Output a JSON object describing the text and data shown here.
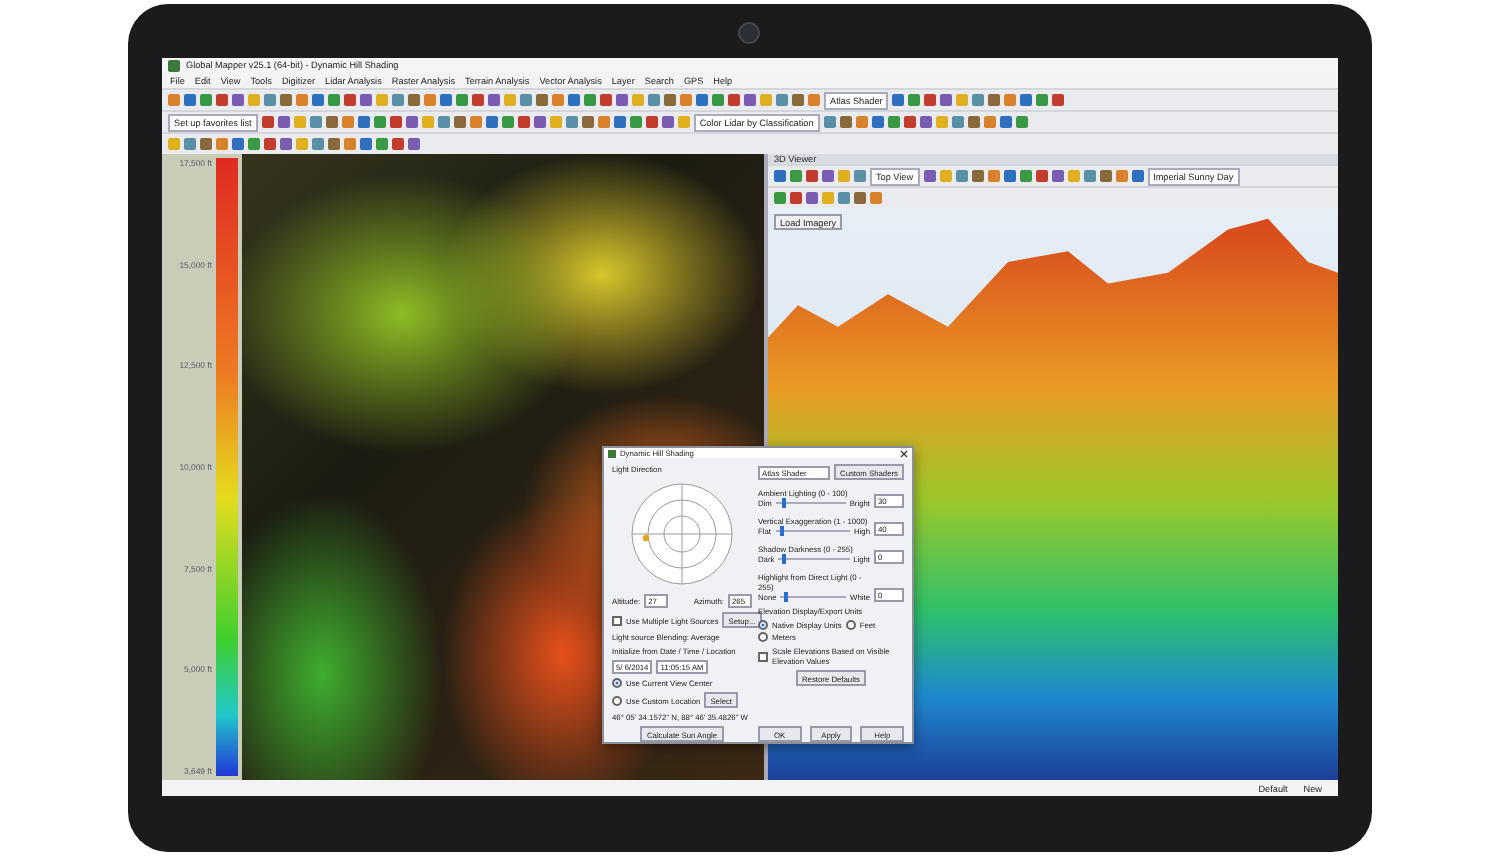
{
  "window": {
    "title": "Global Mapper v25.1 (64-bit) - Dynamic Hill Shading"
  },
  "menu": [
    "File",
    "Edit",
    "View",
    "Tools",
    "Digitizer",
    "Lidar Analysis",
    "Raster Analysis",
    "Terrain Analysis",
    "Vector Analysis",
    "Layer",
    "Search",
    "GPS",
    "Help"
  ],
  "toolbar": {
    "shader_dropdown": "Atlas Shader",
    "favorites_field": "Set up favorites list",
    "lidar_dropdown": "Color Lidar by Classification"
  },
  "map": {
    "scale_labels": [
      "17,500 ft",
      "15,000 ft",
      "12,500 ft",
      "10,000 ft",
      "7,500 ft",
      "5,000 ft",
      "3,649 ft"
    ]
  },
  "viewer_3d": {
    "title": "3D Viewer",
    "view_dropdown": "Top View",
    "style_dropdown": "Imperial Sunny Day",
    "load_button": "Load Imagery"
  },
  "dialog": {
    "title": "Dynamic Hill Shading",
    "light_direction": "Light Direction",
    "shader": "Atlas Shader",
    "custom_button": "Custom Shaders",
    "sliders": [
      {
        "label": "Ambient Lighting (0 - 100)",
        "min": "Dim",
        "max": "Bright",
        "value": "30",
        "level": 0.08
      },
      {
        "label": "Vertical Exaggeration (1 - 1000)",
        "min": "Flat",
        "max": "High",
        "value": "40",
        "level": 0.06
      },
      {
        "label": "Shadow Darkness (0 - 255)",
        "min": "Dark",
        "max": "Light",
        "value": "0",
        "level": 0.05
      },
      {
        "label": "Highlight from Direct Light (0 - 255)",
        "min": "None",
        "max": "White",
        "value": "0",
        "level": 0.05
      }
    ],
    "altitude_label": "Altitude:",
    "altitude": "27",
    "azimuth_label": "Azimuth:",
    "azimuth": "265",
    "multiple_lights": {
      "label": "Use Multiple Light Sources",
      "checked": false
    },
    "setup_button": "Setup...",
    "blending": "Light source Blending: Average",
    "init_label": "Initialize from Date / Time / Location",
    "date": "5/ 6/2014",
    "time": "11:05:15 AM",
    "location_options": [
      {
        "label": "Use Current View Center",
        "selected": true
      },
      {
        "label": "Use Custom Location",
        "selected": false
      }
    ],
    "select_button": "Select",
    "coordinates": "46° 05' 34.1572\" N, 88° 46' 35.4826\" W",
    "calc_button": "Calculate Sun Angle",
    "units_label": "Elevation Display/Export Units",
    "units": [
      {
        "label": "Native Display Units",
        "selected": true
      },
      {
        "label": "Feet",
        "selected": false
      },
      {
        "label": "Meters",
        "selected": false
      }
    ],
    "scale_elevations": {
      "label": "Scale Elevations Based on Visible Elevation Values",
      "checked": false
    },
    "restore_button": "Restore Defaults",
    "buttons": [
      "OK",
      "Apply",
      "Help"
    ]
  },
  "status_bar": [
    "Default",
    "New"
  ]
}
